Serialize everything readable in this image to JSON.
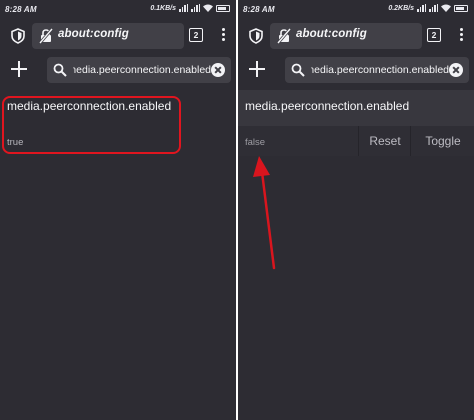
{
  "left": {
    "status": {
      "time": "8:28 AM",
      "rate": "0.1KB/s"
    },
    "url": "about:config",
    "tab_count": "2",
    "search_value": "media.peerconnection.enabled",
    "pref": {
      "name": "media.peerconnection.enabled",
      "value": "true"
    }
  },
  "right": {
    "status": {
      "time": "8:28 AM",
      "rate": "0.2KB/s"
    },
    "url": "about:config",
    "tab_count": "2",
    "search_value": "media.peerconnection.enabled",
    "pref": {
      "name": "media.peerconnection.enabled",
      "value": "false"
    },
    "actions": {
      "reset": "Reset",
      "toggle": "Toggle"
    }
  },
  "icons": {
    "shield": "shield-icon",
    "insecure": "insecure-lock-icon",
    "menu": "three-dot-menu-icon",
    "add": "plus-icon",
    "search": "search-icon",
    "clear": "clear-icon"
  },
  "colors": {
    "background": "#2d2c33",
    "field": "#414047",
    "highlight_annotation": "#e0151f",
    "arrow_annotation": "#d9151e"
  }
}
